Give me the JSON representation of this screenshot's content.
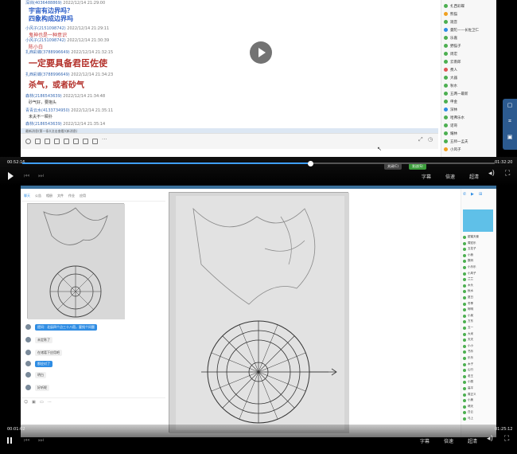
{
  "player1": {
    "chat": {
      "messages": [
        {
          "user": "深圳(4036488869)",
          "time": "2022/12/14 21:29:00",
          "text": "宇宙有边界吗？",
          "color": "#2a5cc7",
          "size": 8
        },
        {
          "user": "",
          "time": "",
          "text": "四象构成边界吗",
          "color": "#2a5cc7",
          "size": 8
        },
        {
          "user": "小风子(2151098742)",
          "time": "2022/12/14 21:29:11",
          "text": "鬼神也是一种意识",
          "color": "#c73a3a",
          "size": 6
        },
        {
          "user": "小风子(2151098742)",
          "time": "2022/12/14 21:30:39",
          "text": "陈小白",
          "color": "#c73a3a",
          "size": 6
        },
        {
          "user": "扎西彩蝶(3788996649)",
          "time": "2022/12/14 21:32:15",
          "text": "一定要具备君臣佐使",
          "color": "#b3302a",
          "size": 11
        },
        {
          "user": "扎西彩蝶(3788996649)",
          "time": "2022/12/14 21:34:23",
          "text": "杀气，或者砂气",
          "color": "#b3302a",
          "size": 10
        },
        {
          "user": "森林(2186543639)",
          "time": "2022/12/14 21:34:48",
          "text": "砂气好，要抱头",
          "color": "#333333",
          "size": 5
        },
        {
          "user": "青青云水(4133734950)",
          "time": "2022/12/14 21:35:11",
          "text": "未夫不一瞬扑",
          "color": "#333333",
          "size": 5
        },
        {
          "user": "森林(2186543639)",
          "time": "2022/12/14 21:35:14",
          "text": "",
          "color": "#333333",
          "size": 5
        }
      ],
      "divider_text": "最新消息(第一条)(点击查看)(新消息)"
    },
    "members": [
      {
        "name": "扎西彩蝶",
        "color": "#4caf50"
      },
      {
        "name": "熊猫",
        "color": "#f0a020"
      },
      {
        "name": "观音",
        "color": "#4caf50"
      },
      {
        "name": "曼陀——长佐卫仁",
        "color": "#2f8de4"
      },
      {
        "name": "乐嘉",
        "color": "#4caf50"
      },
      {
        "name": "野猫子",
        "color": "#4caf50"
      },
      {
        "name": "周宏",
        "color": "#4caf50"
      },
      {
        "name": "云南郎",
        "color": "#4caf50"
      },
      {
        "name": "费人",
        "color": "#e05555"
      },
      {
        "name": "大器",
        "color": "#4caf50"
      },
      {
        "name": "秋水",
        "color": "#4caf50"
      },
      {
        "name": "五两一最新",
        "color": "#4caf50"
      },
      {
        "name": "申金",
        "color": "#4caf50"
      },
      {
        "name": "深林",
        "color": "#2f8de4"
      },
      {
        "name": "哈弗乐水",
        "color": "#4caf50"
      },
      {
        "name": "诺哥",
        "color": "#4caf50"
      },
      {
        "name": "耀林",
        "color": "#4caf50"
      },
      {
        "name": "五师一孟夫",
        "color": "#4caf50"
      },
      {
        "name": "小风子",
        "color": "#f0a020"
      }
    ],
    "side_buttons": [
      "提问工具",
      "截图工具",
      "相册工具"
    ],
    "time_current": "00:52:16",
    "time_total": "01:32:20",
    "progress_fraction": 0.61,
    "controls": {
      "subtitle": "字幕",
      "speed": "倍速",
      "quality": "超清"
    },
    "mini_buttons": [
      {
        "label": "关闭(C)",
        "color": "#444444"
      },
      {
        "label": "发送(S)",
        "color": "#3c9d3c"
      }
    ]
  },
  "player2": {
    "tabs": [
      "聊天",
      "公告",
      "相册",
      "文件",
      "作业",
      "应用"
    ],
    "chat": [
      {
        "text": "提问：北辰四个点三十八宿，要找个问题",
        "style": "blue"
      },
      {
        "text": "未定陈了",
        "style": "gray"
      },
      {
        "text": "在诸葛下应用吧",
        "style": "gray"
      },
      {
        "text": "那应对了",
        "style": "blue"
      },
      {
        "text": "明白",
        "style": "gray"
      },
      {
        "text": "好听呢",
        "style": "gray"
      }
    ],
    "members": [
      "甜蜜天使",
      "周宏乐",
      "五花子",
      "小熊",
      "数码",
      "小乐乐",
      "小风子",
      "兰兰",
      "木头",
      "秋水",
      "夏日",
      "冬季",
      "阿明",
      "小吴",
      "方东",
      "五一",
      "大米",
      "天天",
      "小小",
      "书乐",
      "乐乐",
      "木子",
      "山行",
      "老王",
      "小丽",
      "高平",
      "周正义",
      "小美",
      "晴天",
      "白云",
      "马上"
    ],
    "time_current": "00:01:02",
    "time_total": "01:25:12",
    "controls": {
      "subtitle": "字幕",
      "speed": "倍速",
      "quality": "超清"
    }
  }
}
